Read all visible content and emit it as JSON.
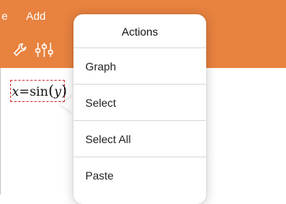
{
  "menubar": {
    "partial_left_label": "e",
    "add_label": "Add"
  },
  "math": {
    "lhs": "x",
    "eq": "=",
    "fn": "sin",
    "open": "(",
    "arg": "y",
    "close": ")"
  },
  "popover": {
    "title": "Actions",
    "items": [
      {
        "label": "Graph"
      },
      {
        "label": "Select"
      },
      {
        "label": "Select All"
      },
      {
        "label": "Paste"
      }
    ]
  },
  "colors": {
    "accent": "#e8823f",
    "selection_border": "#dd3333"
  },
  "icons": [
    "wrench-icon",
    "sliders-icon"
  ]
}
